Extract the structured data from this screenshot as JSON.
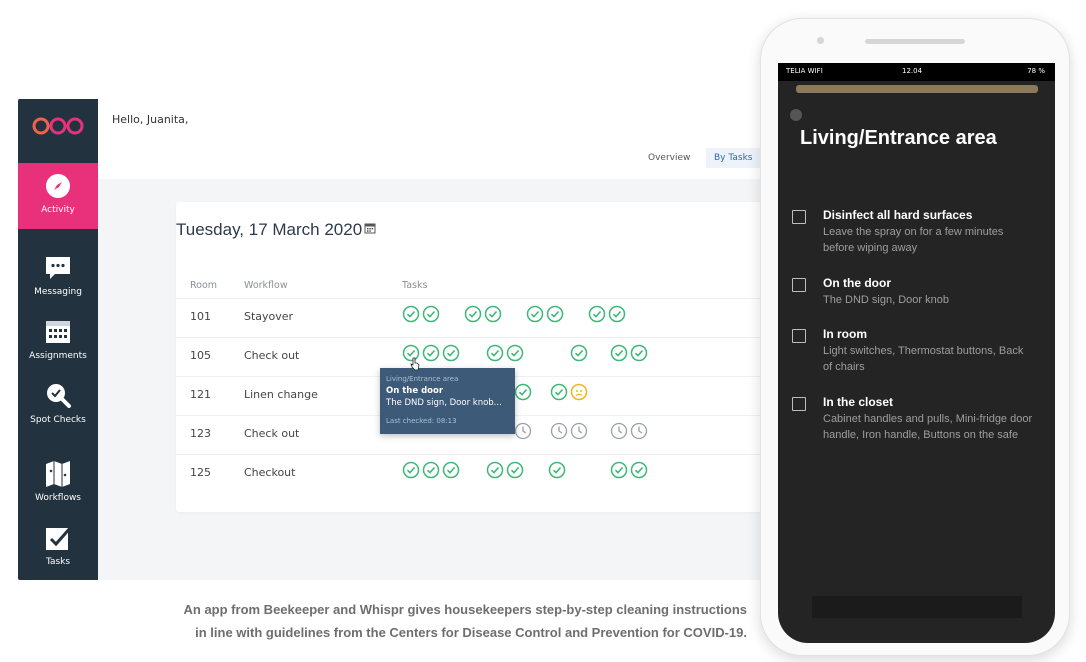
{
  "desktop": {
    "sidebar": {
      "items": [
        {
          "label": "Activity",
          "icon": "compass-icon"
        },
        {
          "label": "Messaging",
          "icon": "chat-icon"
        },
        {
          "label": "Assignments",
          "icon": "calendar-icon"
        },
        {
          "label": "Spot Checks",
          "icon": "search-check-icon"
        },
        {
          "label": "Workflows",
          "icon": "map-icon"
        },
        {
          "label": "Tasks",
          "icon": "checkbox-icon"
        }
      ],
      "active_color": "#e8317a",
      "background": "#22323f"
    },
    "greeting": "Hello, Juanita,",
    "tabs": [
      "Overview",
      "By Tasks"
    ],
    "date": "Tuesday, 17 March 2020",
    "table": {
      "headers": [
        "Room",
        "Workflow",
        "Tasks"
      ],
      "rows": [
        {
          "room": "101",
          "workflow": "Stayover"
        },
        {
          "room": "105",
          "workflow": "Check out"
        },
        {
          "room": "121",
          "workflow": "Linen change"
        },
        {
          "room": "123",
          "workflow": "Check out"
        },
        {
          "room": "125",
          "workflow": "Checkout"
        }
      ]
    },
    "tooltip": {
      "line1": "Living/Entrance area",
      "line2": "On the door",
      "line3": "The DND sign, Door knob...",
      "line4": "Last checked: 08:13"
    }
  },
  "phone": {
    "status": {
      "carrier": "TELIA WIFI",
      "time": "12.04",
      "battery": "78 %"
    },
    "title": "Living/Entrance area",
    "items": [
      {
        "title": "Disinfect all hard surfaces",
        "desc": "Leave the spray on for a few minutes before wiping away"
      },
      {
        "title": "On the door",
        "desc": "The DND sign, Door knob"
      },
      {
        "title": "In room",
        "desc": "Light switches, Thermostat buttons, Back of chairs"
      },
      {
        "title": "In the closet",
        "desc": "Cabinet handles and pulls, Mini-fridge door handle, Iron handle, Buttons on the safe"
      }
    ]
  },
  "caption": {
    "line1": "An app from Beekeeper and Whispr gives housekeepers step-by-step cleaning instructions",
    "line2": "in line with guidelines from the Centers for Disease Control and Prevention for COVID-19."
  }
}
